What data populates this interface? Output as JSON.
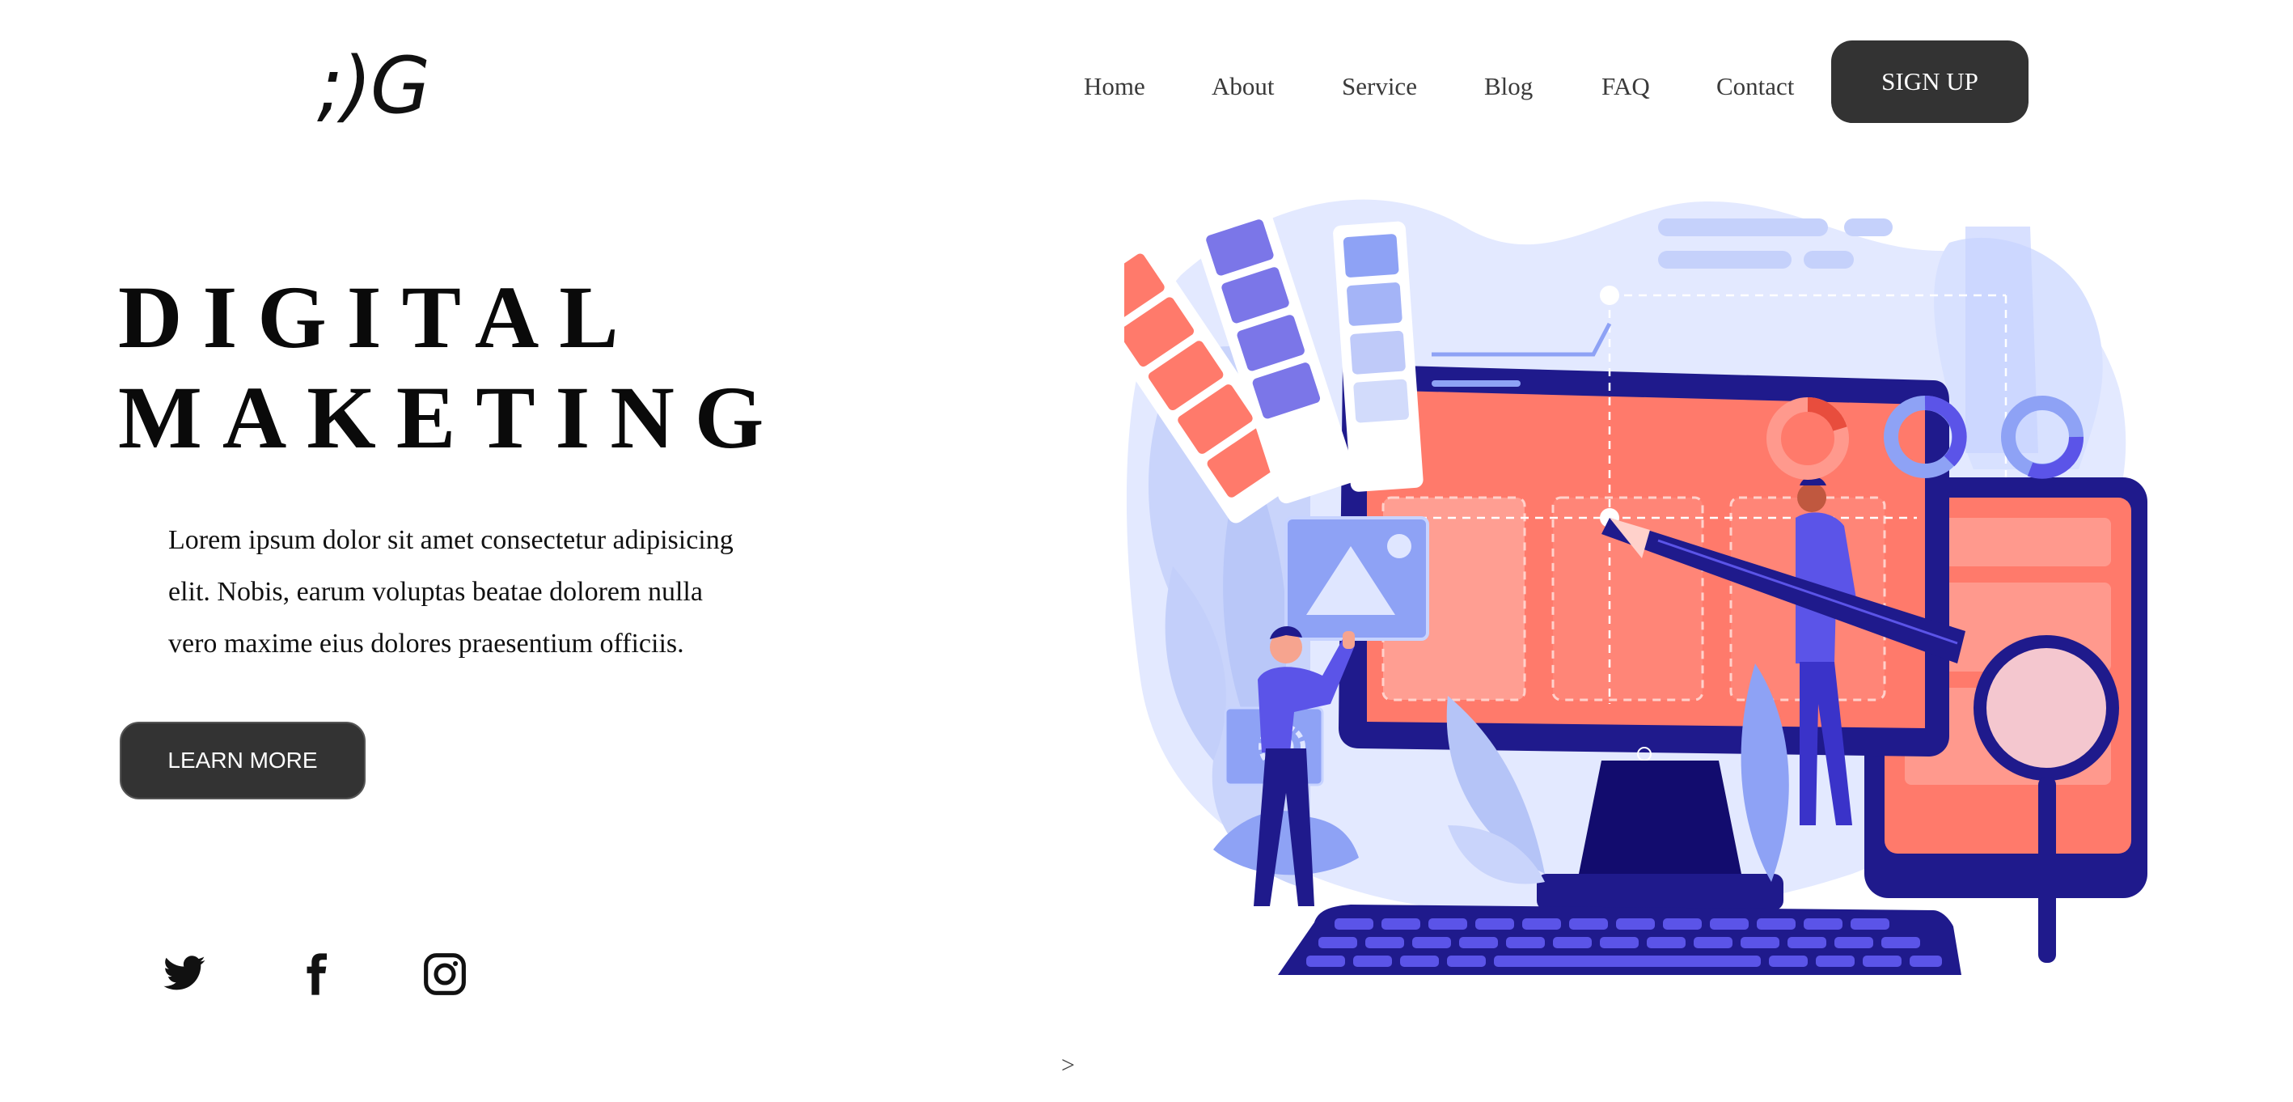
{
  "header": {
    "logo_text": ";)G",
    "nav": [
      "Home",
      "About",
      "Service",
      "Blog",
      "FAQ",
      "Contact"
    ],
    "signup_label": "SIGN UP"
  },
  "hero": {
    "title_line1": "DIGITAL",
    "title_line2": "MAKETING",
    "text_line1": "Lorem ipsum dolor sit amet consectetur adipisicing",
    "text_line2": "elit. Nobis, earum voluptas beatae dolorem nulla",
    "text_line3": "vero maxime eius dolores praesentium officiis.",
    "cta_label": "LEARN MORE"
  },
  "social": {
    "icons": [
      "twitter-icon",
      "facebook-icon",
      "instagram-icon"
    ]
  },
  "footer": {
    "scroll_arrow": ">"
  },
  "colors": {
    "dark_button": "#333333",
    "coral": "#ff7a6b",
    "indigo": "#1f1a8c",
    "periwinkle": "#8ea2f5",
    "light_blue": "#dfe6ff"
  }
}
